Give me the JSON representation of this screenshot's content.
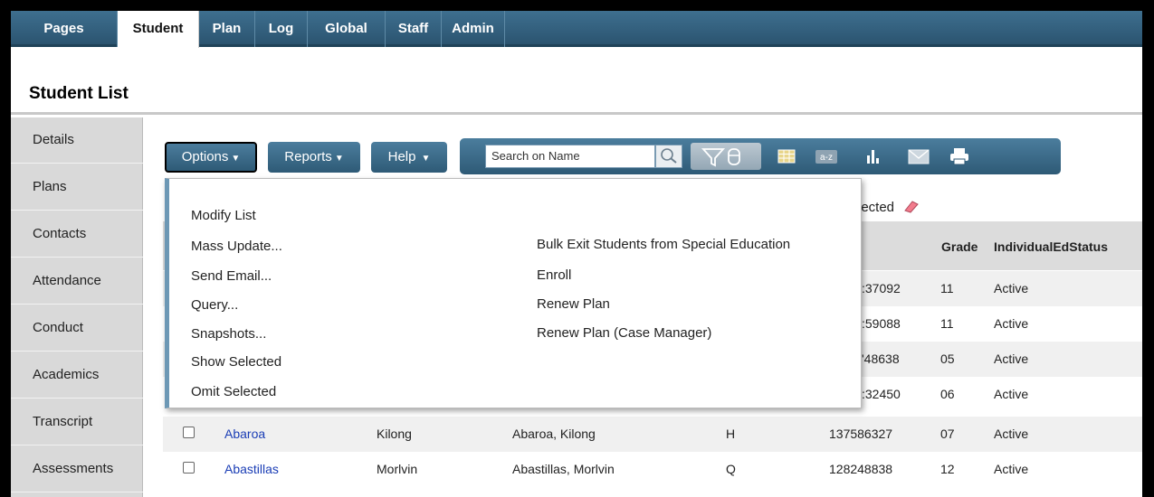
{
  "top_tabs": [
    "Pages",
    "Student",
    "Plan",
    "Log",
    "Global",
    "Staff",
    "Admin"
  ],
  "active_tab": "Student",
  "page_title": "Student List",
  "sidebar": [
    "Details",
    "Plans",
    "Contacts",
    "Attendance",
    "Conduct",
    "Academics",
    "Transcript",
    "Assessments"
  ],
  "toolbar": {
    "options_label": "Options",
    "reports_label": "Reports",
    "help_label": "Help",
    "search_placeholder": "Search on Name"
  },
  "selected_text": "lected",
  "table": {
    "headers": [
      "Grade",
      "IndividualEdStatus"
    ],
    "partial_rows": [
      {
        "id": ":37092",
        "grade": "11",
        "status": "Active"
      },
      {
        "id": ":59088",
        "grade": "11",
        "status": "Active"
      },
      {
        "id": "'48638",
        "grade": "05",
        "status": "Active"
      },
      {
        "id": ":32450",
        "grade": "06",
        "status": "Active"
      }
    ],
    "rows": [
      {
        "last": "Abaroa",
        "first": "Kilong",
        "full": "Abaroa, Kilong",
        "code": "H",
        "id": "137586327",
        "grade": "07",
        "status": "Active"
      },
      {
        "last": "Abastillas",
        "first": "Morlvin",
        "full": "Abastillas, Morlvin",
        "code": "Q",
        "id": "128248838",
        "grade": "12",
        "status": "Active"
      }
    ]
  },
  "options_menu": {
    "left": [
      "Modify List",
      "Mass Update...",
      "Send Email...",
      "Query...",
      "Snapshots...",
      "Show Selected",
      "Omit Selected"
    ],
    "right": [
      "Bulk Exit Students from Special Education",
      "Enroll",
      "Renew Plan",
      "Renew Plan (Case Manager)"
    ]
  }
}
